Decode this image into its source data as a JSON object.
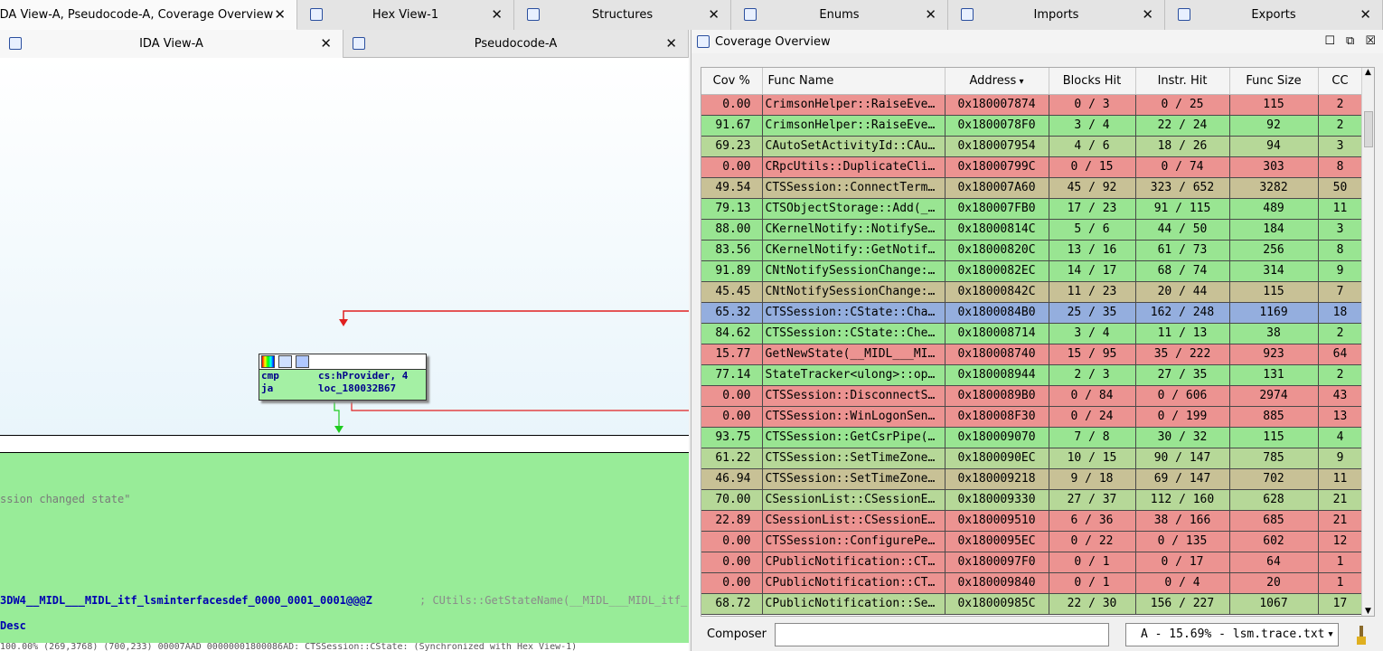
{
  "top_tabs": [
    {
      "label": "IDA View-A, Pseudocode-A, Coverage Overview",
      "icon": "none"
    },
    {
      "label": "Hex View-1",
      "icon": "hex-icon"
    },
    {
      "label": "Structures",
      "icon": "structures-icon"
    },
    {
      "label": "Enums",
      "icon": "enums-icon"
    },
    {
      "label": "Imports",
      "icon": "imports-icon"
    },
    {
      "label": "Exports",
      "icon": "exports-icon"
    }
  ],
  "close_glyph": "✕",
  "sub_tabs": [
    {
      "label": "IDA View-A"
    },
    {
      "label": "Pseudocode-A"
    }
  ],
  "graph": {
    "node_lines": [
      {
        "mnemonic": "cmp",
        "operand": "cs:hProvider, 4"
      },
      {
        "mnemonic": "ja",
        "operand": "loc_180032B67"
      }
    ],
    "block_text": {
      "comment": "ssion changed state\"",
      "symbol": "3DW4__MIDL___MIDL_itf_lsminterfacesdef_0000_0001_0001@@@Z",
      "symbol_comment": "; CUtils::GetStateName(__MIDL___MIDL_itf_",
      "last": "Desc"
    },
    "status_line": "100.00% (269,3768) (700,233) 00007AAD 00000001800086AD: CTSSession::CState: (Synchronized with Hex View-1)"
  },
  "coverage": {
    "title": "Coverage Overview",
    "columns": [
      "Cov %",
      "Func Name",
      "Address",
      "Blocks Hit",
      "Instr. Hit",
      "Func Size",
      "CC"
    ],
    "colors": {
      "red": "#ec9391",
      "green": "#99e592",
      "olive": "#c8c196",
      "yellowgreen": "#b6d898",
      "blue": "#94aede"
    },
    "rows": [
      {
        "cov": "0.00",
        "name": "CrimsonHelper::RaiseEve…",
        "addr": "0x180007874",
        "blocks": "0 / 3",
        "instr": "0 / 25",
        "size": "115",
        "cc": "2",
        "color": "red"
      },
      {
        "cov": "91.67",
        "name": "CrimsonHelper::RaiseEve…",
        "addr": "0x1800078F0",
        "blocks": "3 / 4",
        "instr": "22 / 24",
        "size": "92",
        "cc": "2",
        "color": "green"
      },
      {
        "cov": "69.23",
        "name": "CAutoSetActivityId::CAu…",
        "addr": "0x180007954",
        "blocks": "4 / 6",
        "instr": "18 / 26",
        "size": "94",
        "cc": "3",
        "color": "yellowgreen"
      },
      {
        "cov": "0.00",
        "name": "CRpcUtils::DuplicateCli…",
        "addr": "0x18000799C",
        "blocks": "0 / 15",
        "instr": "0 / 74",
        "size": "303",
        "cc": "8",
        "color": "red"
      },
      {
        "cov": "49.54",
        "name": "CTSSession::ConnectTerm…",
        "addr": "0x180007A60",
        "blocks": "45 / 92",
        "instr": "323 / 652",
        "size": "3282",
        "cc": "50",
        "color": "olive"
      },
      {
        "cov": "79.13",
        "name": "CTSObjectStorage::Add(_…",
        "addr": "0x180007FB0",
        "blocks": "17 / 23",
        "instr": "91 / 115",
        "size": "489",
        "cc": "11",
        "color": "green"
      },
      {
        "cov": "88.00",
        "name": "CKernelNotify::NotifySe…",
        "addr": "0x18000814C",
        "blocks": "5 / 6",
        "instr": "44 / 50",
        "size": "184",
        "cc": "3",
        "color": "green"
      },
      {
        "cov": "83.56",
        "name": "CKernelNotify::GetNotif…",
        "addr": "0x18000820C",
        "blocks": "13 / 16",
        "instr": "61 / 73",
        "size": "256",
        "cc": "8",
        "color": "green"
      },
      {
        "cov": "91.89",
        "name": "CNtNotifySessionChange:…",
        "addr": "0x1800082EC",
        "blocks": "14 / 17",
        "instr": "68 / 74",
        "size": "314",
        "cc": "9",
        "color": "green"
      },
      {
        "cov": "45.45",
        "name": "CNtNotifySessionChange:…",
        "addr": "0x18000842C",
        "blocks": "11 / 23",
        "instr": "20 / 44",
        "size": "115",
        "cc": "7",
        "color": "olive"
      },
      {
        "cov": "65.32",
        "name": "CTSSession::CState::Cha…",
        "addr": "0x1800084B0",
        "blocks": "25 / 35",
        "instr": "162 / 248",
        "size": "1169",
        "cc": "18",
        "color": "blue"
      },
      {
        "cov": "84.62",
        "name": "CTSSession::CState::Che…",
        "addr": "0x180008714",
        "blocks": "3 / 4",
        "instr": "11 / 13",
        "size": "38",
        "cc": "2",
        "color": "green"
      },
      {
        "cov": "15.77",
        "name": "GetNewState(__MIDL___MI…",
        "addr": "0x180008740",
        "blocks": "15 / 95",
        "instr": "35 / 222",
        "size": "923",
        "cc": "64",
        "color": "red"
      },
      {
        "cov": "77.14",
        "name": "StateTracker<ulong>::op…",
        "addr": "0x180008944",
        "blocks": "2 / 3",
        "instr": "27 / 35",
        "size": "131",
        "cc": "2",
        "color": "green"
      },
      {
        "cov": "0.00",
        "name": "CTSSession::DisconnectS…",
        "addr": "0x1800089B0",
        "blocks": "0 / 84",
        "instr": "0 / 606",
        "size": "2974",
        "cc": "43",
        "color": "red"
      },
      {
        "cov": "0.00",
        "name": "CTSSession::WinLogonSen…",
        "addr": "0x180008F30",
        "blocks": "0 / 24",
        "instr": "0 / 199",
        "size": "885",
        "cc": "13",
        "color": "red"
      },
      {
        "cov": "93.75",
        "name": "CTSSession::GetCsrPipe(…",
        "addr": "0x180009070",
        "blocks": "7 / 8",
        "instr": "30 / 32",
        "size": "115",
        "cc": "4",
        "color": "green"
      },
      {
        "cov": "61.22",
        "name": "CTSSession::SetTimeZone…",
        "addr": "0x1800090EC",
        "blocks": "10 / 15",
        "instr": "90 / 147",
        "size": "785",
        "cc": "9",
        "color": "yellowgreen"
      },
      {
        "cov": "46.94",
        "name": "CTSSession::SetTimeZone…",
        "addr": "0x180009218",
        "blocks": "9 / 18",
        "instr": "69 / 147",
        "size": "702",
        "cc": "11",
        "color": "olive"
      },
      {
        "cov": "70.00",
        "name": "CSessionList::CSessionE…",
        "addr": "0x180009330",
        "blocks": "27 / 37",
        "instr": "112 / 160",
        "size": "628",
        "cc": "21",
        "color": "yellowgreen"
      },
      {
        "cov": "22.89",
        "name": "CSessionList::CSessionE…",
        "addr": "0x180009510",
        "blocks": "6 / 36",
        "instr": "38 / 166",
        "size": "685",
        "cc": "21",
        "color": "red"
      },
      {
        "cov": "0.00",
        "name": "CTSSession::ConfigurePe…",
        "addr": "0x1800095EC",
        "blocks": "0 / 22",
        "instr": "0 / 135",
        "size": "602",
        "cc": "12",
        "color": "red"
      },
      {
        "cov": "0.00",
        "name": "CPublicNotification::CT…",
        "addr": "0x1800097F0",
        "blocks": "0 / 1",
        "instr": "0 / 17",
        "size": "64",
        "cc": "1",
        "color": "red"
      },
      {
        "cov": "0.00",
        "name": "CPublicNotification::CT…",
        "addr": "0x180009840",
        "blocks": "0 / 1",
        "instr": "0 / 4",
        "size": "20",
        "cc": "1",
        "color": "red"
      },
      {
        "cov": "68.72",
        "name": "CPublicNotification::Se…",
        "addr": "0x18000985C",
        "blocks": "22 / 30",
        "instr": "156 / 227",
        "size": "1067",
        "cc": "17",
        "color": "yellowgreen"
      }
    ]
  },
  "composer": {
    "label": "Composer",
    "input_value": "",
    "selected_trace": "A - 15.69% - lsm.trace.txt"
  }
}
